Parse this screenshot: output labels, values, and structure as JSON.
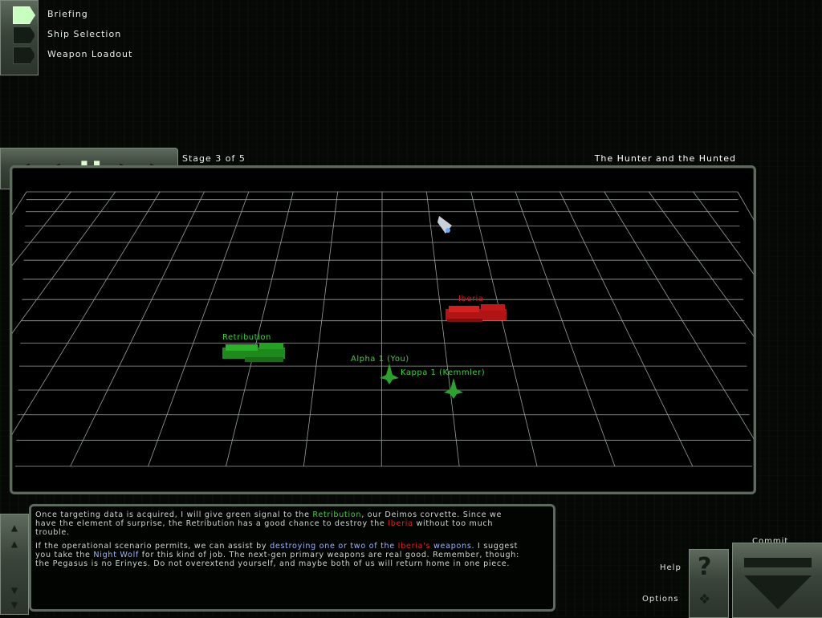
{
  "menu": {
    "items": [
      {
        "label": "Briefing",
        "active": true
      },
      {
        "label": "Ship Selection",
        "active": false
      },
      {
        "label": "Weapon Loadout",
        "active": false
      }
    ]
  },
  "header": {
    "stage": "Stage 3 of 5",
    "title": "The Hunter and the Hunted",
    "controls": [
      "first-stage-icon",
      "prev-stage-icon",
      "pause-icon",
      "next-stage-icon",
      "last-stage-icon"
    ]
  },
  "map": {
    "ships": [
      {
        "label": "Retribution",
        "color": "#3fcf3f"
      },
      {
        "label": "Iberia",
        "color": "#d01818"
      },
      {
        "label": "Alpha 1 (You)",
        "color": "#3fcf3f"
      },
      {
        "label": "Kappa 1 (Kemmler)",
        "color": "#3fcf3f"
      }
    ],
    "grid_color": "#9aa09a"
  },
  "briefing": {
    "p1": {
      "a": "Once targeting data is acquired, I will give green signal to the ",
      "b": "Retribution",
      "c": ", our Deimos corvette.  Since we have the element of surprise, the Retribution has a good chance to destroy the ",
      "d": "Iberia",
      "e": " without too much trouble."
    },
    "p2": {
      "a": "If the operational scenario permits, we can assist by ",
      "b": "destroying one or two of the ",
      "c": "Iberia's",
      "d": " weapons",
      "e": ".  I suggest you take the ",
      "f": "Night Wolf",
      "g": " for this kind of job.  The next-gen primary weapons are real good.  Remember, though: the Pegasus is no Erinyes.  Do not overextend yourself, and maybe both of us will return home in one piece."
    }
  },
  "buttons": {
    "commit": "Commit",
    "help": "Help",
    "options": "Options"
  }
}
